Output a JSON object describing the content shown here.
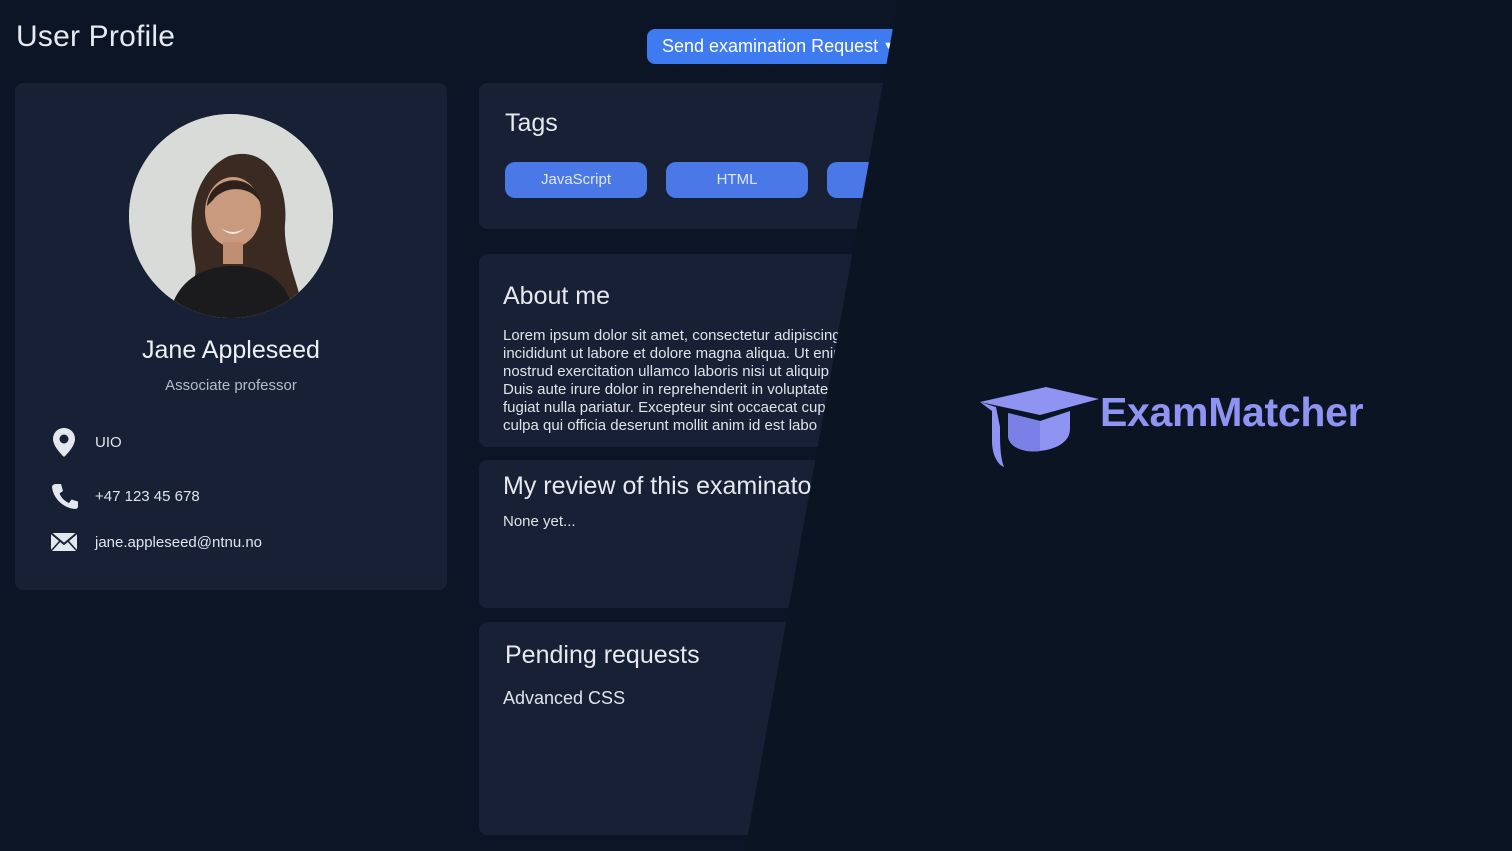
{
  "page": {
    "title": "User Profile"
  },
  "actions": {
    "send_request_label": "Send examination Request"
  },
  "profile": {
    "name": "Jane Appleseed",
    "role": "Associate professor",
    "location": "UIO",
    "phone": "+47 123 45 678",
    "email": "jane.appleseed@ntnu.no"
  },
  "tags": {
    "title": "Tags",
    "items": [
      "JavaScript",
      "HTML",
      ""
    ]
  },
  "about": {
    "title": "About me",
    "lines": [
      "Lorem ipsum dolor sit amet, consectetur adipiscing",
      "incididunt ut labore et dolore magna aliqua. Ut enim",
      "nostrud exercitation ullamco laboris nisi ut aliquip",
      "Duis aute irure dolor in reprehenderit in voluptate",
      "fugiat nulla pariatur. Excepteur sint occaecat cup",
      "culpa qui officia deserunt mollit anim id est labo"
    ]
  },
  "review": {
    "title": "My review of this examinato",
    "text": "None yet..."
  },
  "pending": {
    "title": "Pending requests",
    "items": [
      "Advanced CSS"
    ]
  },
  "brand": {
    "name": "ExamMatcher",
    "logo_icon": "graduation-cap-icon",
    "color": "#8f93f2"
  },
  "colors": {
    "accent": "#3f7bf0",
    "tag": "#4a78e6",
    "card": "#172034",
    "background": "#0c1526"
  }
}
